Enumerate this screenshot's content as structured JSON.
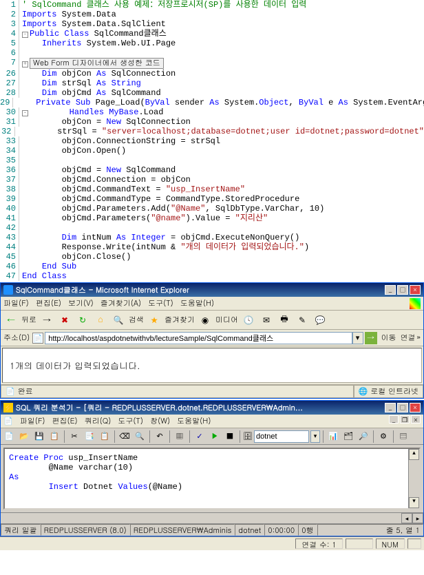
{
  "code": {
    "lines": [
      {
        "num": "1",
        "content": [
          {
            "t": "' SqlCommand 클래스 사용 예제：저장프로시저(SP)를 사용한 데이터 입력",
            "cls": "cmt"
          }
        ]
      },
      {
        "num": "2",
        "content": [
          {
            "t": "Imports",
            "cls": "kw"
          },
          {
            "t": " System.Data"
          }
        ]
      },
      {
        "num": "3",
        "content": [
          {
            "t": "Imports",
            "cls": "kw"
          },
          {
            "t": " System.Data.SqlClient"
          }
        ]
      },
      {
        "num": "4",
        "prefix": "minus",
        "content": [
          {
            "t": "Public Class",
            "cls": "kw"
          },
          {
            "t": " SqlCommand클래스"
          }
        ]
      },
      {
        "num": "5",
        "content": [
          {
            "t": "    "
          },
          {
            "t": "Inherits",
            "cls": "kw"
          },
          {
            "t": " System.Web.UI.Page"
          }
        ]
      },
      {
        "num": "6",
        "content": [
          {
            "t": " "
          }
        ]
      },
      {
        "num": "7",
        "box": "Web Form 디자이너에서 생성한 코드"
      },
      {
        "num": "26",
        "content": [
          {
            "t": "    "
          },
          {
            "t": "Dim",
            "cls": "kw"
          },
          {
            "t": " objCon "
          },
          {
            "t": "As",
            "cls": "kw"
          },
          {
            "t": " SqlConnection"
          }
        ]
      },
      {
        "num": "27",
        "content": [
          {
            "t": "    "
          },
          {
            "t": "Dim",
            "cls": "kw"
          },
          {
            "t": " strSql "
          },
          {
            "t": "As String",
            "cls": "kw"
          }
        ]
      },
      {
        "num": "28",
        "content": [
          {
            "t": "    "
          },
          {
            "t": "Dim",
            "cls": "kw"
          },
          {
            "t": " objCmd "
          },
          {
            "t": "As",
            "cls": "kw"
          },
          {
            "t": " SqlCommand"
          }
        ]
      },
      {
        "num": "29",
        "content": [
          {
            "t": "    "
          },
          {
            "t": "Private Sub",
            "cls": "kw"
          },
          {
            "t": " Page_Load("
          },
          {
            "t": "ByVal",
            "cls": "kw"
          },
          {
            "t": " sender "
          },
          {
            "t": "As",
            "cls": "kw"
          },
          {
            "t": " System."
          },
          {
            "t": "Object",
            "cls": "kw"
          },
          {
            "t": ", "
          },
          {
            "t": "ByVal",
            "cls": "kw"
          },
          {
            "t": " e "
          },
          {
            "t": "As",
            "cls": "kw"
          },
          {
            "t": " System.EventArgs) _"
          }
        ]
      },
      {
        "num": "30",
        "prefix": "minus",
        "content": [
          {
            "t": "        "
          },
          {
            "t": "Handles MyBase",
            "cls": "kw"
          },
          {
            "t": ".Load"
          }
        ]
      },
      {
        "num": "31",
        "content": [
          {
            "t": "        objCon = "
          },
          {
            "t": "New",
            "cls": "kw"
          },
          {
            "t": " SqlConnection"
          }
        ]
      },
      {
        "num": "32",
        "content": [
          {
            "t": "        strSql = "
          },
          {
            "t": "\"server=localhost;database=dotnet;user id=dotnet;password=dotnet\"",
            "cls": "str"
          }
        ]
      },
      {
        "num": "33",
        "content": [
          {
            "t": "        objCon.ConnectionString = strSql"
          }
        ]
      },
      {
        "num": "34",
        "content": [
          {
            "t": "        objCon.Open"
          },
          {
            "t": "()",
            "cls": ""
          }
        ]
      },
      {
        "num": "35",
        "content": [
          {
            "t": " "
          }
        ]
      },
      {
        "num": "36",
        "content": [
          {
            "t": "        objCmd = "
          },
          {
            "t": "New",
            "cls": "kw"
          },
          {
            "t": " SqlCommand"
          }
        ]
      },
      {
        "num": "37",
        "content": [
          {
            "t": "        objCmd.Connection = objCon"
          }
        ]
      },
      {
        "num": "38",
        "content": [
          {
            "t": "        objCmd.CommandText = "
          },
          {
            "t": "\"usp_InsertName\"",
            "cls": "str"
          }
        ]
      },
      {
        "num": "39",
        "content": [
          {
            "t": "        objCmd.CommandType = CommandType.StoredProcedure"
          }
        ]
      },
      {
        "num": "40",
        "content": [
          {
            "t": "        objCmd.Parameters.Add("
          },
          {
            "t": "\"@Name\"",
            "cls": "str"
          },
          {
            "t": ", SqlDbType.VarChar, 10)"
          }
        ]
      },
      {
        "num": "41",
        "content": [
          {
            "t": "        objCmd.Parameters("
          },
          {
            "t": "\"@name\"",
            "cls": "str"
          },
          {
            "t": ").Value = "
          },
          {
            "t": "\"지리산\"",
            "cls": "str"
          }
        ]
      },
      {
        "num": "42",
        "content": [
          {
            "t": " "
          }
        ]
      },
      {
        "num": "43",
        "content": [
          {
            "t": "        "
          },
          {
            "t": "Dim",
            "cls": "kw"
          },
          {
            "t": " intNum "
          },
          {
            "t": "As Integer",
            "cls": "kw"
          },
          {
            "t": " = objCmd.ExecuteNonQuery"
          },
          {
            "t": "()"
          }
        ]
      },
      {
        "num": "44",
        "content": [
          {
            "t": "        Response.Write(intNum & "
          },
          {
            "t": "\"개의 데이터가 입력되었습니다.\"",
            "cls": "str"
          },
          {
            "t": ")"
          }
        ]
      },
      {
        "num": "45",
        "content": [
          {
            "t": "        objCon.Close"
          },
          {
            "t": "()"
          }
        ]
      },
      {
        "num": "46",
        "content": [
          {
            "t": "    "
          },
          {
            "t": "End Sub",
            "cls": "kw"
          }
        ]
      },
      {
        "num": "47",
        "content": [
          {
            "t": ""
          },
          {
            "t": "End Class",
            "cls": "kw"
          }
        ]
      }
    ]
  },
  "ie": {
    "title": "SqlCommand클래스 - Microsoft Internet Explorer",
    "menu": [
      "파일(F)",
      "편집(E)",
      "보기(V)",
      "즐겨찾기(A)",
      "도구(T)",
      "도움말(H)"
    ],
    "toolbar": {
      "back": "뒤로",
      "search": "검색",
      "fav": "즐겨찾기",
      "media": "미디어"
    },
    "address_label": "주소(D)",
    "url": "http://localhost/aspdotnetwithvb/lectureSample/SqlCommand클래스",
    "go": "이동",
    "links": "연결",
    "content": "1개의 데이터가 입력되었습니다.",
    "status_done": "완료",
    "status_zone": "로컬 인트라넷"
  },
  "qa": {
    "title": "SQL 쿼리 분석기 - [쿼리 - REDPLUSSERVER.dotnet.REDPLUSSERVER\\Admin...",
    "menu": [
      "파일(F)",
      "편집(E)",
      "쿼리(Q)",
      "도구(T)",
      "창(W)",
      "도움말(H)"
    ],
    "db": "dotnet",
    "sql": {
      "line1_kw": "Create Proc",
      "line1_rest": " usp_InsertName",
      "line2": "        @Name varchar(10)",
      "line3": "As",
      "line4_pre": "        ",
      "line4_insert": "Insert",
      "line4_mid": " Dotnet ",
      "line4_values": "Values",
      "line4_rest": "(@Name)"
    },
    "status": {
      "s1": "쿼리 일괄",
      "s2": "REDPLUSSERVER (8.0)",
      "s3": "REDPLUSSERVER\\Adminis",
      "s4": "dotnet",
      "s5": "0:00:00",
      "s6": "0행",
      "s7": "줄 5, 열 1"
    }
  },
  "bottom": {
    "conn": "연결 수: 1",
    "num": "NUM"
  }
}
